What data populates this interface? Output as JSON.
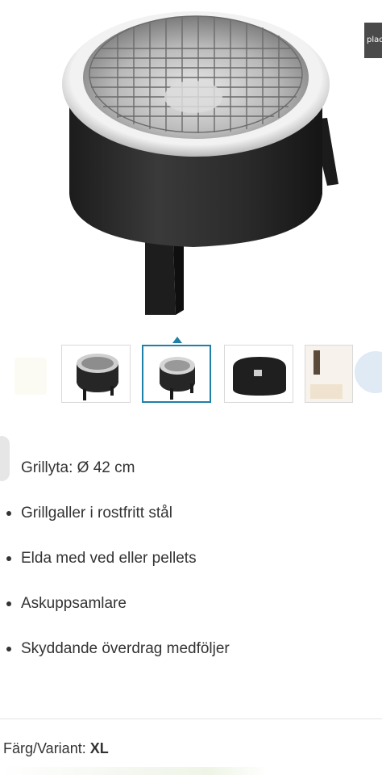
{
  "product": {
    "image_alt": "grill-product-image",
    "corner_badge": "plaq"
  },
  "thumbnails": [
    {
      "name": "thumb-grill-side",
      "active": false
    },
    {
      "name": "thumb-grill-front",
      "active": true
    },
    {
      "name": "thumb-grill-cover",
      "active": false
    },
    {
      "name": "thumb-grill-lifestyle",
      "active": false
    }
  ],
  "features": [
    "Grillyta: Ø 42 cm",
    "Grillgaller i rostfritt stål",
    "Elda med ved eller pellets",
    "Askuppsamlare",
    "Skyddande överdrag medföljer"
  ],
  "variant": {
    "label": "Färg/Variant:",
    "value": "XL"
  }
}
